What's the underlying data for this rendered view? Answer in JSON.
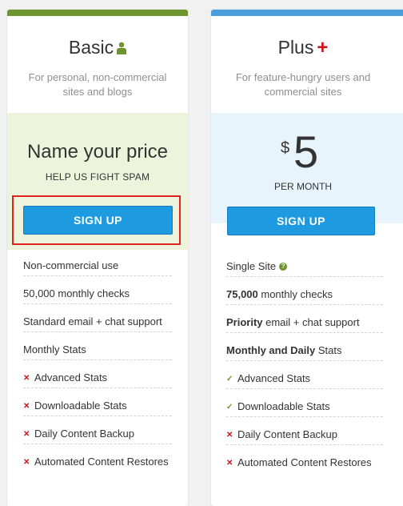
{
  "colors": {
    "basic_accent": "#6d942e",
    "plus_accent": "#4a9fd9",
    "button": "#1e9be0",
    "highlight": "#e02424",
    "cross": "#c8161e",
    "check": "#6d942e"
  },
  "basic": {
    "title": "Basic",
    "title_icon": "person-icon",
    "description": "For personal, non-commercial sites and blogs",
    "price_heading": "Name your price",
    "price_subheading": "HELP US FIGHT SPAM",
    "signup_label": "SIGN UP",
    "features": [
      {
        "icon": "none",
        "text": "Non-commercial use"
      },
      {
        "icon": "none",
        "text": "50,000 monthly checks"
      },
      {
        "icon": "none",
        "text": "Standard email + chat support"
      },
      {
        "icon": "none",
        "text": "Monthly Stats"
      },
      {
        "icon": "cross-icon",
        "text": "Advanced Stats"
      },
      {
        "icon": "cross-icon",
        "text": "Downloadable Stats"
      },
      {
        "icon": "cross-icon",
        "text": "Daily Content Backup"
      },
      {
        "icon": "cross-icon",
        "text": "Automated Content Restores"
      }
    ]
  },
  "plus": {
    "title": "Plus",
    "title_icon": "plus-icon",
    "description": "For feature-hungry users and commercial sites",
    "price_currency": "$",
    "price_amount": "5",
    "price_period": "PER MONTH",
    "signup_label": "SIGN UP",
    "features": [
      {
        "icon": "none",
        "text": "Single Site",
        "suffix_icon": "help-icon"
      },
      {
        "icon": "none",
        "bold": "75,000",
        "text": " monthly checks"
      },
      {
        "icon": "none",
        "bold": "Priority",
        "text": " email + chat support"
      },
      {
        "icon": "none",
        "bold": "Monthly and Daily",
        "text": " Stats"
      },
      {
        "icon": "check-icon",
        "text": "Advanced Stats"
      },
      {
        "icon": "check-icon",
        "text": "Downloadable Stats"
      },
      {
        "icon": "cross-icon",
        "text": "Daily Content Backup"
      },
      {
        "icon": "cross-icon",
        "text": "Automated Content Restores"
      }
    ]
  }
}
